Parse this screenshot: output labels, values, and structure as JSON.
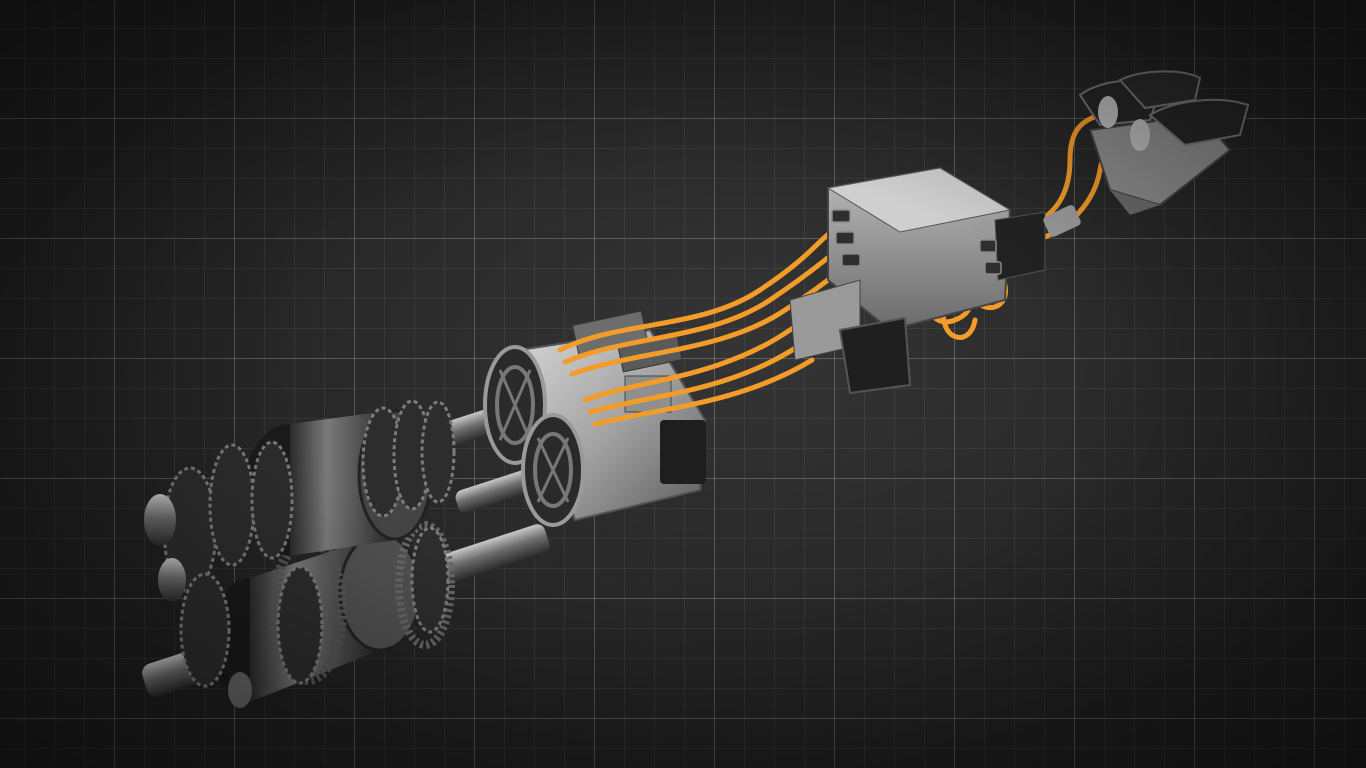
{
  "scene": {
    "subject": "",
    "colors": {
      "background": "#202020",
      "grid": "#ffffff",
      "metal": "#8a8a8a",
      "metal_dark": "#3a3a3a",
      "cable": "#f39c2a",
      "casing": "#b8b8b8"
    }
  }
}
